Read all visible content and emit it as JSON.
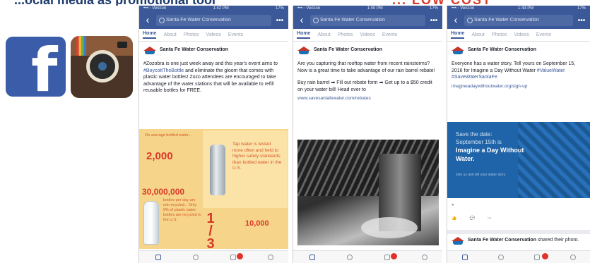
{
  "slide": {
    "title_left": "...ocial media as promotional tool",
    "title_right": "... LOW COST"
  },
  "logos": {
    "facebook": "f",
    "instagram_icon": "camera-icon"
  },
  "phones": [
    {
      "status": {
        "carrier": "•••◦◦ Verizon",
        "time": "1:42 PM",
        "battery": "17%"
      },
      "search": "Santa Fe Water Conservation",
      "tabs": [
        "Home",
        "About",
        "Photos",
        "Videos",
        "Events"
      ],
      "post": {
        "page_name": "Santa Fe Water Conservation",
        "time": "·",
        "text_1": "#Zozobra is one just week away and this year's event aims to ",
        "text_hash": "#BoycottTheBottle",
        "text_2": " and eliminate the gloom that comes with plastic water bottles! Zozo attendees are encouraged to take advantage of the water stations that will be available to refill reusable bottles for FREE."
      },
      "infographic": {
        "stat1": "2,000",
        "stat1_note": "On average bottled water...",
        "stat2": "30,000,000",
        "stat3": "10,000",
        "third": "1 / 3",
        "tap_text": "Tap water is tested more often and held to higher safety standards than bottled water in the U.S.",
        "plastic_text": "bottles per day are not recycled... Only 9% of plastic water bottles are recycled in the U.S."
      }
    },
    {
      "status": {
        "carrier": "•••◦◦ Verizon",
        "time": "1:40 PM",
        "battery": "17%"
      },
      "search": "Santa Fe Water Conservation",
      "tabs": [
        "Home",
        "About",
        "Photos",
        "Videos",
        "Events"
      ],
      "post": {
        "page_name": "Santa Fe Water Conservation",
        "time": "·",
        "text_1": "Are you capturing that rooftop water from recent rainstorms? Now is a great time to take advantage of our rain barrel rebate!",
        "text_2": "Buy rain barrel ➡ Fill out rebate form ➡ Get up to a $50 credit on your water bill! Head over to",
        "link": "www.savesantafewater.com/rebates"
      }
    },
    {
      "status": {
        "carrier": "•••◦◦ Verizon",
        "time": "1:43 PM",
        "battery": "17%"
      },
      "search": "Santa Fe Water Conservation",
      "tabs": [
        "Home",
        "About",
        "Photos",
        "Videos",
        "Events"
      ],
      "post": {
        "page_name": "Santa Fe Water Conservation",
        "time": "·",
        "text_1": "Everyone has a water story. Tell yours on September 15, 2016 for Imagine a Day Without Water ",
        "text_hash": "#ValueWater #SaveWaterSantaFe",
        "link": "imagineadaywithoutwater.org/sign-up"
      },
      "banner": {
        "line1": "Save the date:",
        "line2": "September 15th is",
        "headline": "Imagine a Day Without Water.",
        "small": "Join us and tell your water story"
      },
      "shared": {
        "name": "Santa Fe Water Conservation",
        "action": "shared their photo."
      }
    }
  ],
  "colors": {
    "fb_blue": "#3b5998",
    "accent_red": "#e0322a",
    "infographic_yellow": "#f6d58a"
  }
}
